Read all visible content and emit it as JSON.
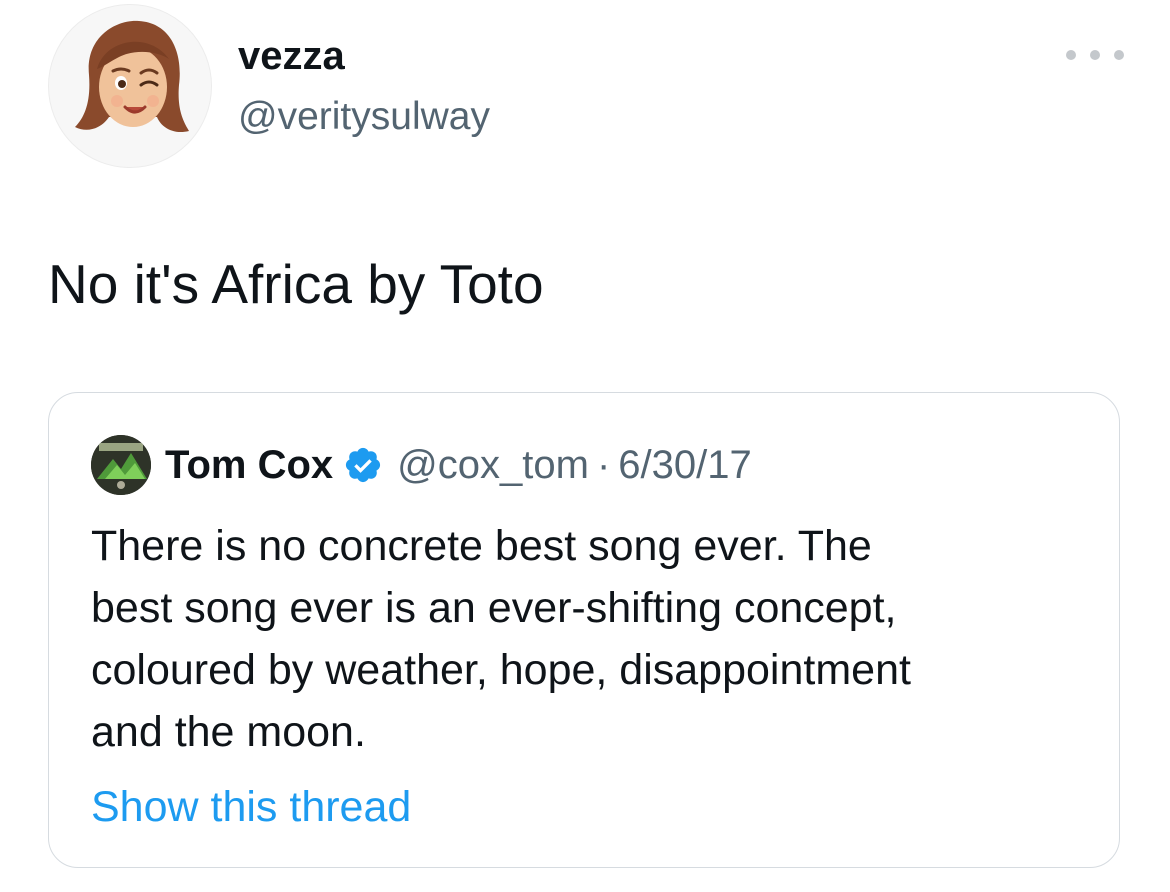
{
  "author": {
    "display_name": "vezza",
    "handle": "@veritysulway",
    "avatar_icon": "memoji-avatar-icon"
  },
  "menu": {
    "more_icon": "more-horizontal-icon"
  },
  "tweet": {
    "text": "No it's Africa by Toto"
  },
  "quoted_tweet": {
    "author_name": "Tom Cox",
    "verified_icon": "verified-badge-icon",
    "handle": "@cox_tom",
    "separator": "·",
    "date": "6/30/17",
    "text_lines": [
      "There is no concrete best song ever. The",
      "best song ever is an ever-shifting concept,",
      "coloured by weather, hope, disappointment",
      "and the moon."
    ],
    "show_thread_label": "Show this thread"
  },
  "colors": {
    "text_primary": "#0f1419",
    "text_secondary": "#536471",
    "link": "#1d9bf0",
    "verified": "#1d9bf0",
    "border": "#d6dbe0"
  }
}
